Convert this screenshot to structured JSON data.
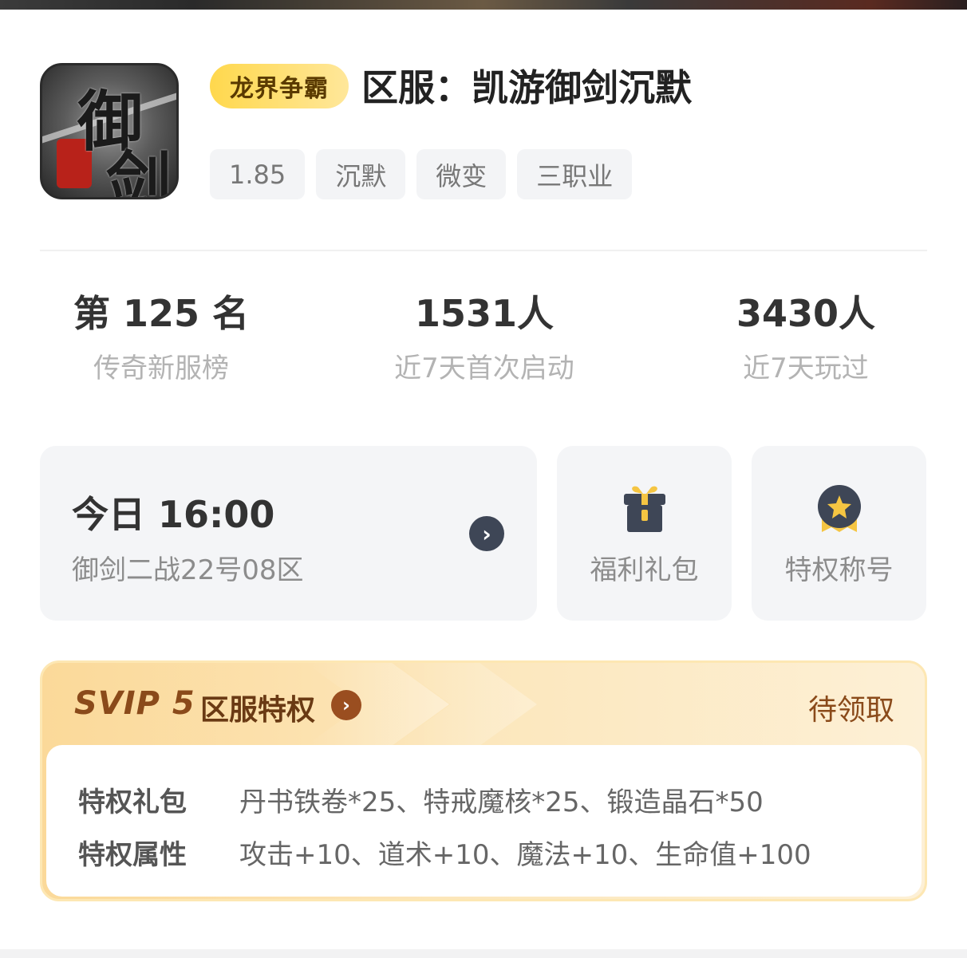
{
  "header": {
    "badge": "龙界争霸",
    "title": "区服：凯游御剑沉默",
    "tags": [
      "1.85",
      "沉默",
      "微变",
      "三职业"
    ],
    "app_icon": {
      "icon": "game-logo-icon"
    }
  },
  "stats": [
    {
      "value": "第 125 名",
      "label": "传奇新服榜"
    },
    {
      "value": "1531人",
      "label": "近7天首次启动"
    },
    {
      "value": "3430人",
      "label": "近7天玩过"
    }
  ],
  "server_card": {
    "time": "今日 16:00",
    "name": "御剑二战22号08区",
    "icon": "chevron-right-icon"
  },
  "actions": [
    {
      "label": "福利礼包",
      "icon": "gift-icon"
    },
    {
      "label": "特权称号",
      "icon": "medal-icon"
    }
  ],
  "svip": {
    "level": "SVIP 5",
    "title": "区服特权",
    "status": "待领取",
    "rows": [
      {
        "key": "特权礼包",
        "value": "丹书铁卷*25、特戒魔核*25、锻造晶石*50"
      },
      {
        "key": "特权属性",
        "value": "攻击+10、道术+10、魔法+10、生命值+100"
      }
    ]
  },
  "colors": {
    "badge": "#ffd84d",
    "svip_bg": "#fbd999",
    "svip_text": "#8a4a1a",
    "card_bg": "#f4f5f7"
  }
}
